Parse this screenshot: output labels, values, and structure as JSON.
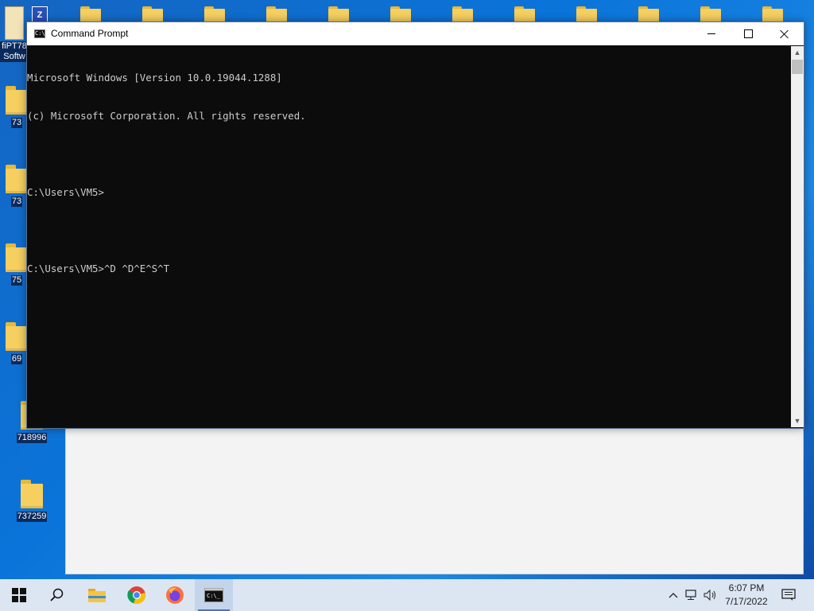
{
  "desktop": {
    "left_icons": [
      {
        "label": "fiPT78 Softw"
      },
      {
        "label": "73"
      },
      {
        "label": "73"
      },
      {
        "label": "75"
      },
      {
        "label": "69"
      },
      {
        "label": "718996"
      },
      {
        "label": "737259"
      }
    ]
  },
  "cmd_window": {
    "title": "Command Prompt",
    "icon_text": "C:\\",
    "lines": [
      "Microsoft Windows [Version 10.0.19044.1288]",
      "(c) Microsoft Corporation. All rights reserved.",
      "",
      "C:\\Users\\VM5>",
      "",
      "C:\\Users\\VM5>^D ^D^E^S^T"
    ],
    "minimize_icon": "minimize-icon",
    "maximize_icon": "maximize-icon",
    "close_icon": "close-icon"
  },
  "taskbar": {
    "start_icon": "windows-start-icon",
    "search_icon": "search-icon",
    "apps": [
      "file-explorer-icon",
      "chrome-icon",
      "firefox-icon",
      "command-prompt-icon"
    ],
    "tray": [
      "chevron-up-icon",
      "network-icon",
      "volume-icon"
    ],
    "time": "6:07 PM",
    "date": "7/17/2022",
    "notification_icon": "notification-icon"
  },
  "colors": {
    "accent": "#3c78c8",
    "console_bg": "#0c0c0c",
    "console_text": "#cccccc",
    "taskbar_bg": "#dce6f3"
  }
}
